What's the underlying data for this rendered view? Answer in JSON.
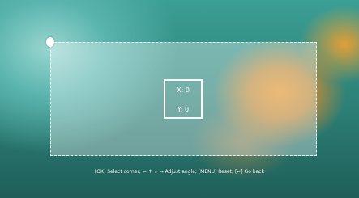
{
  "keystone": {
    "x_label": "X: 0",
    "y_label": "Y: 0"
  },
  "footer": {
    "hint": "[OK] Select corner; ← ↑ ↓ → Adjust angle; [MENU] Reset; [↩] Go back"
  },
  "colors": {
    "overlay_fill": "rgba(255,255,255,0.35)",
    "overlay_border": "#ffffff",
    "text": "#ffffff"
  },
  "icons": {
    "corner_handle": "corner-handle-icon"
  }
}
